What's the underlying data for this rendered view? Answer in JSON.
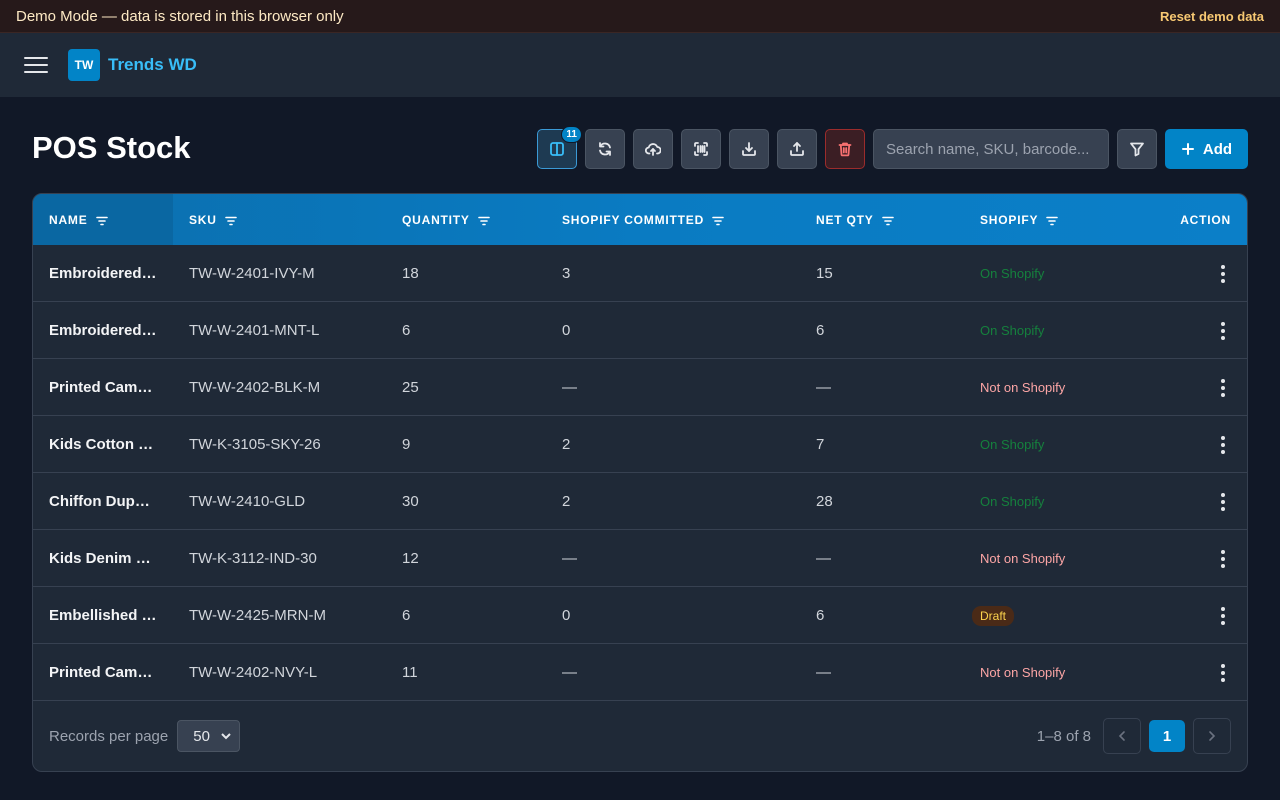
{
  "demo_banner": {
    "text": "Demo Mode — data is stored in this browser only",
    "reset_label": "Reset demo data"
  },
  "brand": {
    "initials": "TW",
    "name": "Trends WD"
  },
  "page": {
    "title": "POS Stock"
  },
  "toolbar": {
    "columns_badge": "11",
    "search_placeholder": "Search name, SKU, barcode...",
    "add_label": "Add"
  },
  "table": {
    "headers": {
      "name": "NAME",
      "sku": "SKU",
      "quantity": "QUANTITY",
      "committed": "SHOPIFY COMMITTED",
      "net": "NET QTY",
      "shopify": "SHOPIFY",
      "action": "ACTION"
    },
    "rows": [
      {
        "name": "Embroidered Kurta",
        "sku": "TW-W-2401-IVY-M",
        "quantity": "18",
        "committed": "3",
        "net": "15",
        "shopify": "On Shopify"
      },
      {
        "name": "Embroidered Kurta",
        "sku": "TW-W-2401-MNT-L",
        "quantity": "6",
        "committed": "0",
        "net": "6",
        "shopify": "On Shopify"
      },
      {
        "name": "Printed Cambric Suit",
        "sku": "TW-W-2402-BLK-M",
        "quantity": "25",
        "committed": "—",
        "net": "—",
        "shopify": "Not on Shopify"
      },
      {
        "name": "Kids Cotton Kurta",
        "sku": "TW-K-3105-SKY-26",
        "quantity": "9",
        "committed": "2",
        "net": "7",
        "shopify": "On Shopify"
      },
      {
        "name": "Chiffon Dupatta",
        "sku": "TW-W-2410-GLD",
        "quantity": "30",
        "committed": "2",
        "net": "28",
        "shopify": "On Shopify"
      },
      {
        "name": "Kids Denim Jeans",
        "sku": "TW-K-3112-IND-30",
        "quantity": "12",
        "committed": "—",
        "net": "—",
        "shopify": "Not on Shopify"
      },
      {
        "name": "Embellished Shirt",
        "sku": "TW-W-2425-MRN-M",
        "quantity": "6",
        "committed": "0",
        "net": "6",
        "shopify": "Draft"
      },
      {
        "name": "Printed Cambric Suit",
        "sku": "TW-W-2402-NVY-L",
        "quantity": "11",
        "committed": "—",
        "net": "—",
        "shopify": "Not on Shopify"
      }
    ]
  },
  "footer": {
    "records_label": "Records per page",
    "records_value": "50",
    "range": "1–8 of 8",
    "current_page": "1"
  },
  "colors": {
    "accent": "#0284c7",
    "on_shopify": "#15803d",
    "not_on_shopify": "#fca5a5",
    "draft_bg": "#4a2a17",
    "draft_text": "#fcd34d"
  }
}
